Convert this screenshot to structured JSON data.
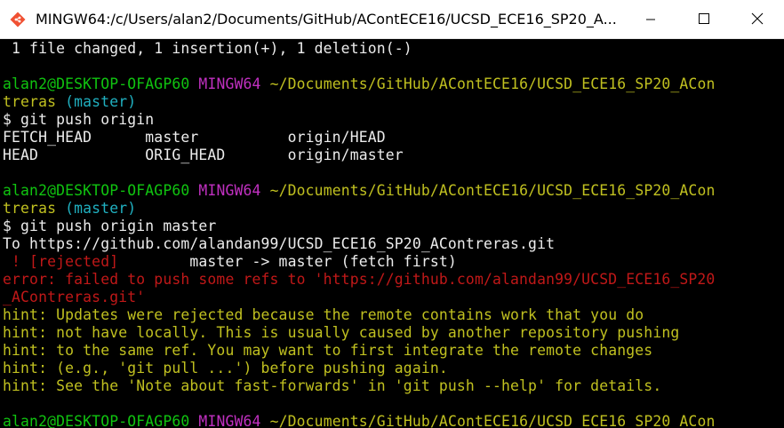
{
  "window": {
    "title": "MINGW64:/c/Users/alan2/Documents/GitHub/AContECE16/UCSD_ECE16_SP20_A...",
    "minimize_icon": "minimize-icon",
    "maximize_icon": "maximize-icon",
    "close_icon": "close-icon"
  },
  "colors": {
    "prompt_user": "#10c410",
    "prompt_env": "#c030c0",
    "prompt_path": "#c0c020",
    "branch": "#20b0c0",
    "error": "#c01818",
    "hint": "#c0c020"
  },
  "terminal": {
    "summary": " 1 file changed, 1 insertion(+), 1 deletion(-)",
    "prompts": [
      {
        "user": "alan2@DESKTOP-OFAGP60",
        "env": "MINGW64",
        "path": " ~/Documents/GitHub/AContECE16/UCSD_ECE16_SP20_ACon",
        "path_wrap": "treras",
        "branch": " (master)",
        "command": "$ git push origin"
      },
      {
        "user": "alan2@DESKTOP-OFAGP60",
        "env": "MINGW64",
        "path": " ~/Documents/GitHub/AContECE16/UCSD_ECE16_SP20_ACon",
        "path_wrap": "treras",
        "branch": " (master)",
        "command": "$ git push origin master"
      },
      {
        "user": "alan2@DESKTOP-OFAGP60",
        "env": "MINGW64",
        "path": " ~/Documents/GitHub/AContECE16/UCSD_ECE16_SP20_ACon"
      }
    ],
    "completions": [
      "FETCH_HEAD      master          origin/HEAD",
      "HEAD            ORIG_HEAD       origin/master"
    ],
    "push_to": "To https://github.com/alandan99/UCSD_ECE16_SP20_AContreras.git",
    "rejected_tag": " ! [rejected]",
    "rejected_detail": "        master -> master (fetch first)",
    "error_lines": [
      "error: failed to push some refs to 'https://github.com/alandan99/UCSD_ECE16_SP20",
      "_AContreras.git'"
    ],
    "hints": [
      "hint: Updates were rejected because the remote contains work that you do",
      "hint: not have locally. This is usually caused by another repository pushing",
      "hint: to the same ref. You may want to first integrate the remote changes",
      "hint: (e.g., 'git pull ...') before pushing again.",
      "hint: See the 'Note about fast-forwards' in 'git push --help' for details."
    ]
  }
}
